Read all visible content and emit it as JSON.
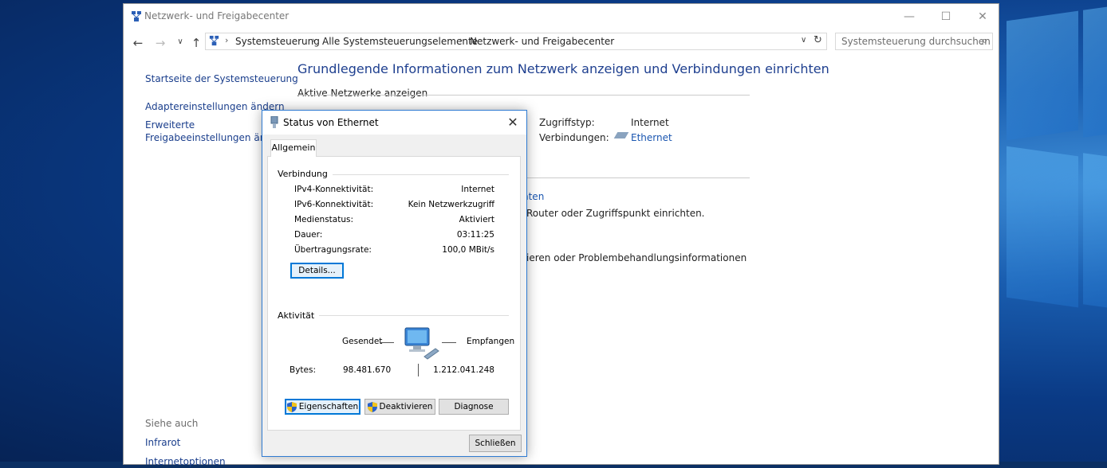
{
  "main_window": {
    "title": "Netzwerk- und Freigabecenter",
    "breadcrumb": [
      "Systemsteuerung",
      "Alle Systemsteuerungselemente",
      "Netzwerk- und Freigabecenter"
    ],
    "search_placeholder": "Systemsteuerung durchsuchen",
    "left_pane": {
      "links": [
        "Startseite der Systemsteuerung",
        "Adaptereinstellungen ändern",
        "Erweiterte",
        "Freigabeeinstellungen ändern"
      ],
      "see_also_heading": "Siehe auch",
      "see_also": [
        "Infrarot",
        "Internetoptionen"
      ]
    },
    "content": {
      "title": "Grundlegende Informationen zum Netzwerk anzeigen und Verbindungen einrichten",
      "active_networks_label": "Aktive Netzwerke anzeigen",
      "access_type_label": "Zugriffstyp:",
      "access_type_value": "Internet",
      "connections_label": "Verbindungen:",
      "connections_value": "Ethernet",
      "partial_link": "nten",
      "partial_text_1": "Router oder Zugriffspunkt einrichten.",
      "partial_text_2": "ieren oder Problembehandlungsinformationen"
    }
  },
  "dialog": {
    "title": "Status von Ethernet",
    "tab": "Allgemein",
    "connection_group": "Verbindung",
    "rows": [
      {
        "label": "IPv4-Konnektivität:",
        "value": "Internet"
      },
      {
        "label": "IPv6-Konnektivität:",
        "value": "Kein Netzwerkzugriff"
      },
      {
        "label": "Medienstatus:",
        "value": "Aktiviert"
      },
      {
        "label": "Dauer:",
        "value": "03:11:25"
      },
      {
        "label": "Übertragungsrate:",
        "value": "100,0 MBit/s"
      }
    ],
    "details_button": "Details...",
    "activity_group": "Aktivität",
    "sent_label": "Gesendet",
    "received_label": "Empfangen",
    "bytes_label": "Bytes:",
    "bytes_sent": "98.481.670",
    "bytes_received": "1.212.041.248",
    "buttons": {
      "properties": "Eigenschaften",
      "disable": "Deaktivieren",
      "diagnose": "Diagnose"
    },
    "close_button": "Schließen"
  },
  "colors": {
    "link": "#1a3e8c",
    "title_blue": "#1e3f8f",
    "focus": "#0078d7"
  }
}
